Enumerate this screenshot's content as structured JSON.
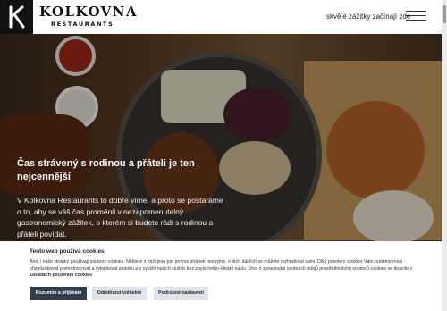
{
  "header": {
    "brand_name": "KOLKOVNA",
    "brand_sub": "RESTAURANTS",
    "tagline": "skvělé zážitky začínají zde"
  },
  "hero": {
    "title": "Čas strávený s rodinou a přáteli je ten nejcennější",
    "body": "V Kolkovna Restaurants to dobře víme, a proto se postaráme o to, aby se váš čas proměnil v nezapomenutelný gastronomický zážitek, o kterém si budete rádi s rodinou a přáteli povídat."
  },
  "cookie": {
    "title": "Tento web používá cookies",
    "text": "Ano, i naše stránky používají soubory cookies. Některé z nich jsou pro provoz stránek nezbytné, o těch dalších se můžete rozhodnout sami. Díky povolení cookies Vám budeme moci přizpůsobovat přehodnocovat a vylepšovat stránku a z využití našich služeb bez zbytečného klikání navíc. Více o zpracování osobních údajů prostřednictvím souborů cookies se dozvíte v",
    "link": "Zásadách používání cookies",
    "buttons": {
      "accept_all": "Rozumím a přijímám",
      "accept_optional": "Odmítnout volitelné",
      "settings": "Podrobné nastavení"
    }
  }
}
